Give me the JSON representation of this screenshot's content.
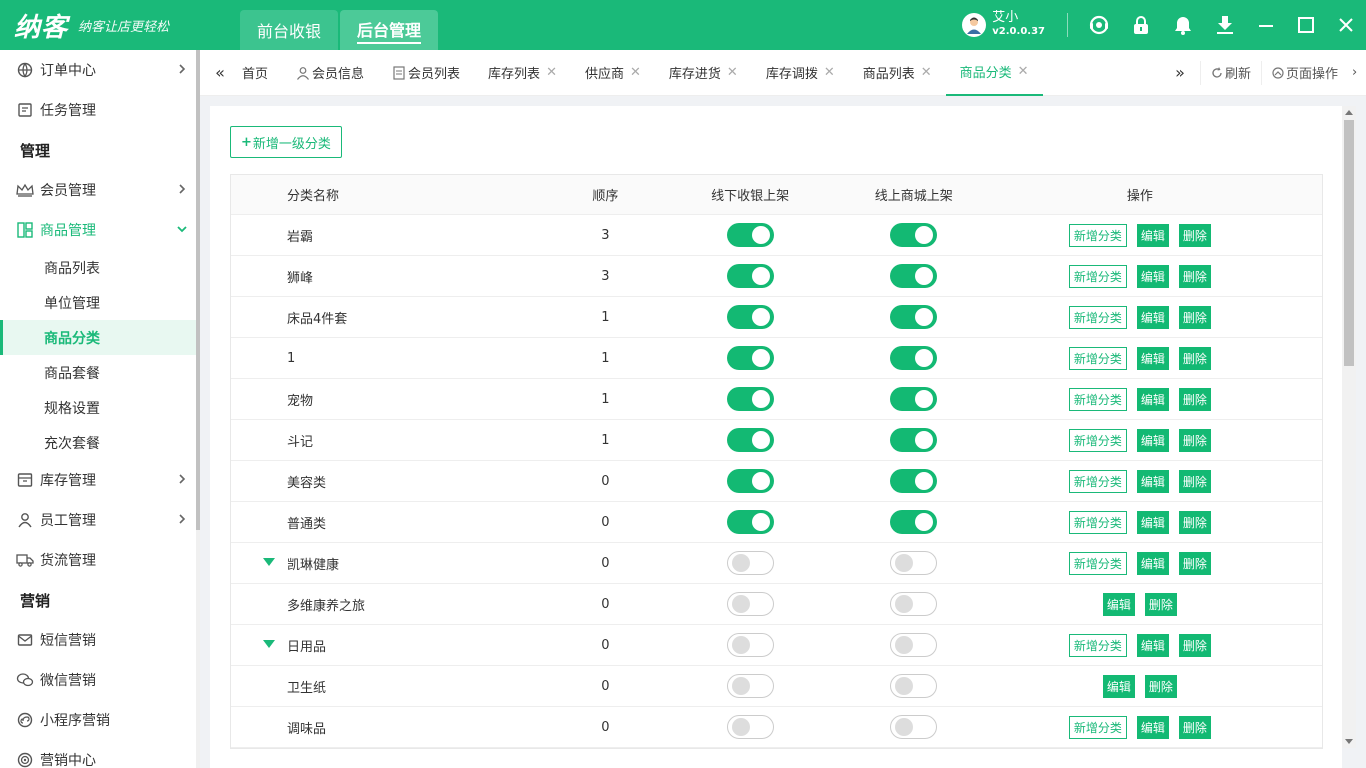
{
  "app": {
    "logo": "纳客",
    "slogan": "纳客让店更轻松",
    "modes": [
      "前台收银",
      "后台管理"
    ],
    "active_mode": 1,
    "user_name": "艾小",
    "version": "v2.0.0.37",
    "accent": "#1ab979"
  },
  "sidebar": {
    "items": [
      {
        "type": "item",
        "label": "订单中心",
        "icon": "order-icon",
        "arrow": true
      },
      {
        "type": "item",
        "label": "任务管理",
        "icon": "task-icon"
      },
      {
        "type": "group",
        "label": "管理"
      },
      {
        "type": "item",
        "label": "会员管理",
        "icon": "crown-icon",
        "arrow": true
      },
      {
        "type": "item",
        "label": "商品管理",
        "icon": "goods-icon",
        "open": true
      },
      {
        "type": "sub",
        "label": "商品列表"
      },
      {
        "type": "sub",
        "label": "单位管理"
      },
      {
        "type": "sub",
        "label": "商品分类",
        "active": true
      },
      {
        "type": "sub",
        "label": "商品套餐"
      },
      {
        "type": "sub",
        "label": "规格设置"
      },
      {
        "type": "sub",
        "label": "充次套餐"
      },
      {
        "type": "item",
        "label": "库存管理",
        "icon": "inventory-icon",
        "arrow": true
      },
      {
        "type": "item",
        "label": "员工管理",
        "icon": "staff-icon",
        "arrow": true
      },
      {
        "type": "item",
        "label": "货流管理",
        "icon": "truck-icon"
      },
      {
        "type": "group",
        "label": "营销"
      },
      {
        "type": "item",
        "label": "短信营销",
        "icon": "sms-icon"
      },
      {
        "type": "item",
        "label": "微信营销",
        "icon": "wechat-icon"
      },
      {
        "type": "item",
        "label": "小程序营销",
        "icon": "miniprogram-icon"
      },
      {
        "type": "item",
        "label": "营销中心",
        "icon": "target-icon"
      }
    ]
  },
  "tabs": {
    "items": [
      {
        "label": "首页",
        "closable": false
      },
      {
        "label": "会员信息",
        "closable": false,
        "icon": "user-icon"
      },
      {
        "label": "会员列表",
        "closable": false,
        "icon": "doc-icon"
      },
      {
        "label": "库存列表",
        "closable": true
      },
      {
        "label": "供应商",
        "closable": true
      },
      {
        "label": "库存进货",
        "closable": true
      },
      {
        "label": "库存调拨",
        "closable": true
      },
      {
        "label": "商品列表",
        "closable": true
      },
      {
        "label": "商品分类",
        "closable": true,
        "active": true
      }
    ],
    "refresh": "刷新",
    "page_ops": "页面操作"
  },
  "content": {
    "add_button": "新增一级分类",
    "headers": {
      "name": "分类名称",
      "order": "顺序",
      "offline": "线下收银上架",
      "online": "线上商城上架",
      "ops": "操作"
    },
    "op_labels": {
      "add": "新增分类",
      "edit": "编辑",
      "delete": "删除"
    },
    "rows": [
      {
        "name": "岩霸",
        "order": "3",
        "offline": true,
        "online": true,
        "can_add": true
      },
      {
        "name": "狮峰",
        "order": "3",
        "offline": true,
        "online": true,
        "can_add": true
      },
      {
        "name": "床品4件套",
        "order": "1",
        "offline": true,
        "online": true,
        "can_add": true
      },
      {
        "name": "1",
        "order": "1",
        "offline": true,
        "online": true,
        "can_add": true
      },
      {
        "name": "宠物",
        "order": "1",
        "offline": true,
        "online": true,
        "can_add": true
      },
      {
        "name": "斗记",
        "order": "1",
        "offline": true,
        "online": true,
        "can_add": true
      },
      {
        "name": "美容类",
        "order": "0",
        "offline": true,
        "online": true,
        "can_add": true
      },
      {
        "name": "普通类",
        "order": "0",
        "offline": true,
        "online": true,
        "can_add": true
      },
      {
        "name": "凯琳健康",
        "order": "0",
        "offline": false,
        "online": false,
        "can_add": true,
        "expanded": true
      },
      {
        "name": "多维康养之旅",
        "order": "0",
        "offline": false,
        "online": false,
        "can_add": false
      },
      {
        "name": "日用品",
        "order": "0",
        "offline": false,
        "online": false,
        "can_add": true,
        "expanded": true
      },
      {
        "name": "卫生纸",
        "order": "0",
        "offline": false,
        "online": false,
        "can_add": false
      },
      {
        "name": "调味品",
        "order": "0",
        "offline": false,
        "online": false,
        "can_add": true
      }
    ]
  }
}
